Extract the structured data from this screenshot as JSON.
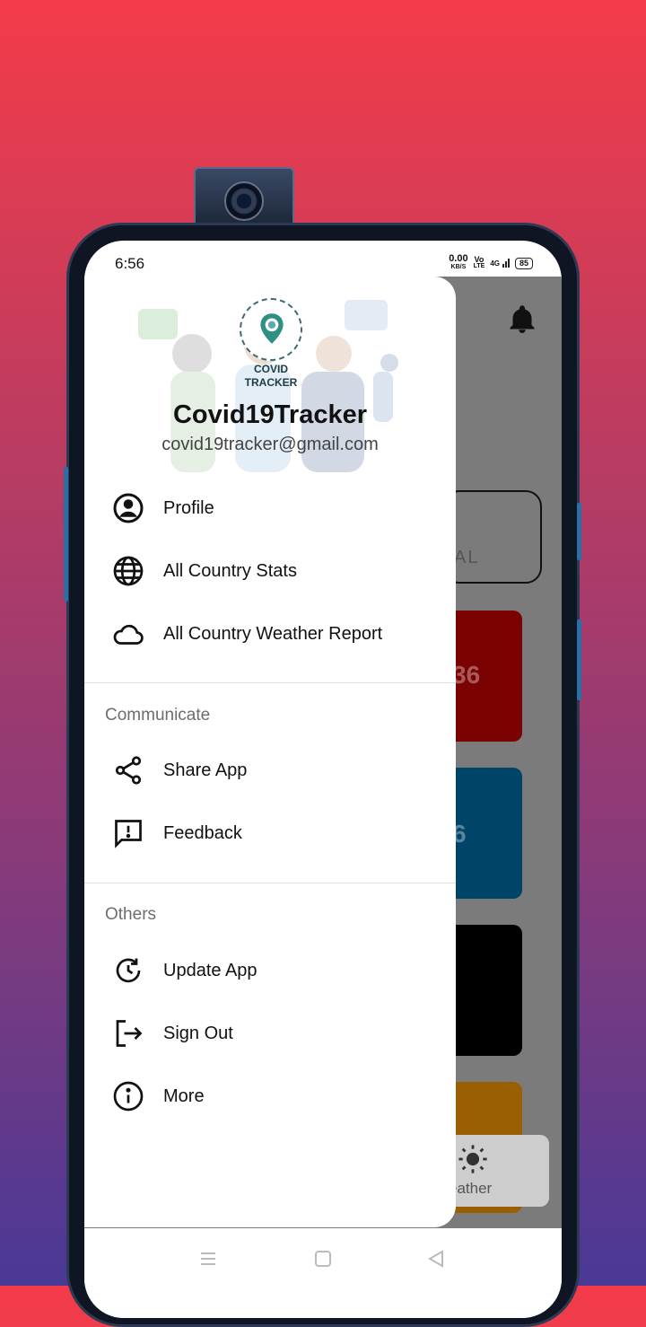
{
  "status_bar": {
    "time": "6:56",
    "speed": "0.00",
    "speed_unit": "KB/S",
    "volte_top": "Vo",
    "volte_bottom": "LTE",
    "network": "4G",
    "battery": "85"
  },
  "drawer": {
    "logo_line1": "COVID",
    "logo_line2": "TRACKER",
    "app_name": "Covid19Tracker",
    "email": "covid19tracker@gmail.com",
    "main_items": [
      {
        "label": "Profile",
        "icon": "account-circle-icon"
      },
      {
        "label": "All Country Stats",
        "icon": "globe-icon"
      },
      {
        "label": "All Country Weather Report",
        "icon": "cloud-icon"
      }
    ],
    "sections": [
      {
        "title": "Communicate",
        "items": [
          {
            "label": "Share App",
            "icon": "share-icon"
          },
          {
            "label": "Feedback",
            "icon": "feedback-icon"
          }
        ]
      },
      {
        "title": "Others",
        "items": [
          {
            "label": "Update App",
            "icon": "update-icon"
          },
          {
            "label": "Sign Out",
            "icon": "sign-out-icon"
          },
          {
            "label": "More",
            "icon": "info-icon"
          }
        ]
      }
    ]
  },
  "background_app": {
    "bell_icon": "bell-icon",
    "outlined_card_text": "AL",
    "card1_value": "36",
    "card2_value": "6",
    "weather_label": "eather",
    "colors": {
      "overlay": "#7b7b7b",
      "card_red": "#7a0202",
      "card_blue": "#004468",
      "card_black": "#000000",
      "card_orange": "#9a5f00"
    }
  },
  "colors": {
    "gradient_top": "#f43b49",
    "gradient_bottom": "#4a3996",
    "text_primary": "#111111",
    "text_secondary": "#6d6d6d"
  }
}
